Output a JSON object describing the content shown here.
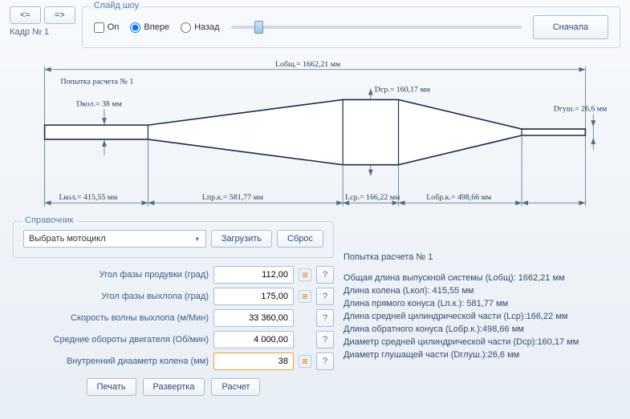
{
  "nav": {
    "prev": "<=",
    "next": "=>",
    "frame_label": "Кадр № 1"
  },
  "slideshow": {
    "title": "Слайд шоу",
    "on_label": "On",
    "forward_label": "Впере",
    "back_label": "Назад",
    "restart_label": "Сначала"
  },
  "diagram": {
    "title": "Попытка расчета № 1",
    "l_total": "Lобщ.= 1662,21 мм",
    "d_col": "Dкол.= 38 мм",
    "d_cp": "Dср.= 160,17 мм",
    "d_muff": "Dгуш.= 26,6 мм",
    "l_col": "Lкол.= 415,55 мм",
    "l_pr": "Lпр.к.= 581,77 мм",
    "l_cp": "Lср.= 166,22 мм",
    "l_obr": "Lобр.к.= 498,66 мм"
  },
  "reference": {
    "title": "Справочник",
    "select_placeholder": "Выбрать мотоцикл",
    "load": "Загрузить",
    "reset": "Сброс"
  },
  "params": [
    {
      "label": "Угол фазы продувки (град)",
      "value": "112,00",
      "calc": true
    },
    {
      "label": "Угол фазы выхлопа (град)",
      "value": "175,00",
      "calc": true
    },
    {
      "label": "Скорость волны выхлопа (м/Мин)",
      "value": "33 360,00",
      "calc": false
    },
    {
      "label": "Средние обороты двигателя (Об/мин)",
      "value": "4 000,00",
      "calc": false
    },
    {
      "label": "Внутренний диааметр колена (мм)",
      "value": "38",
      "calc": true,
      "active": true
    }
  ],
  "actions": {
    "print": "Печать",
    "unfold": "Развертка",
    "calculate": "Расчет"
  },
  "results": {
    "title": "Попытка расчета № 1",
    "lines": [
      "Общая длина выпускной системы (Lобщ): 1662,21 мм",
      "Длина колена (Lкол): 415,55 мм",
      "Длина прямого конуса (Lп.к.): 581,77 мм",
      "Длина средней цилиндрической части (Lср):166,22 мм",
      "Длина обратного конуса (Lобр.к.):498,66 мм",
      "Диаметр средней цилиндрической части (Dср):160,17 мм",
      "Диаметр глушащей части (Dглуш.):26,6 мм"
    ]
  },
  "help": "?"
}
